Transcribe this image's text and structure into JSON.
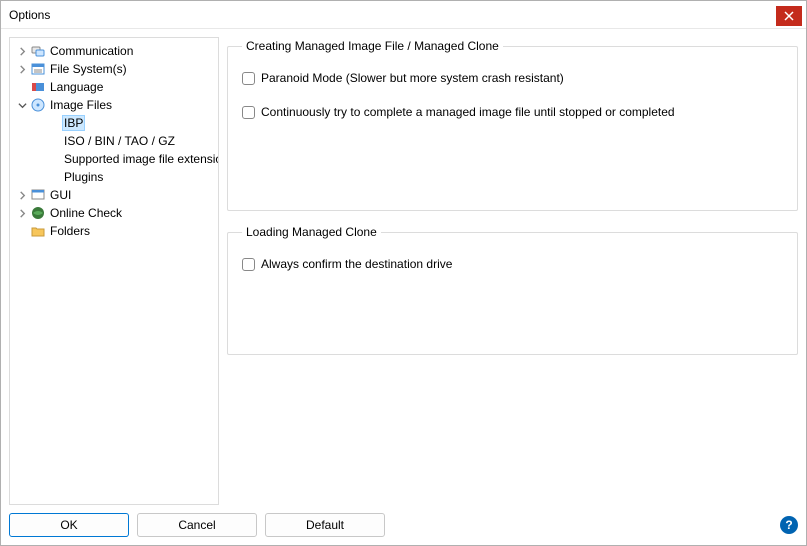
{
  "window": {
    "title": "Options"
  },
  "tree": {
    "items": [
      {
        "label": "Communication",
        "hasChildren": true,
        "expanded": false,
        "level": 1,
        "icon": "comm"
      },
      {
        "label": "File System(s)",
        "hasChildren": true,
        "expanded": false,
        "level": 1,
        "icon": "fs"
      },
      {
        "label": "Language",
        "hasChildren": false,
        "level": 1,
        "icon": "lang"
      },
      {
        "label": "Image Files",
        "hasChildren": true,
        "expanded": true,
        "level": 1,
        "icon": "image"
      },
      {
        "label": "IBP",
        "hasChildren": false,
        "level": 2,
        "selected": true
      },
      {
        "label": "ISO / BIN / TAO / GZ",
        "hasChildren": false,
        "level": 2
      },
      {
        "label": "Supported image file extension",
        "hasChildren": false,
        "level": 2
      },
      {
        "label": "Plugins",
        "hasChildren": false,
        "level": 2
      },
      {
        "label": "GUI",
        "hasChildren": true,
        "expanded": false,
        "level": 1,
        "icon": "gui"
      },
      {
        "label": "Online Check",
        "hasChildren": true,
        "expanded": false,
        "level": 1,
        "icon": "online"
      },
      {
        "label": "Folders",
        "hasChildren": false,
        "level": 1,
        "icon": "folder"
      }
    ]
  },
  "groups": {
    "creating": {
      "legend": "Creating Managed Image File / Managed Clone",
      "paranoid": "Paranoid Mode (Slower but more system crash resistant)",
      "continuous": "Continuously try to complete a managed image file until stopped or completed"
    },
    "loading": {
      "legend": "Loading Managed Clone",
      "confirm": "Always confirm the destination drive"
    }
  },
  "buttons": {
    "ok": "OK",
    "cancel": "Cancel",
    "default": "Default",
    "help": "?"
  }
}
